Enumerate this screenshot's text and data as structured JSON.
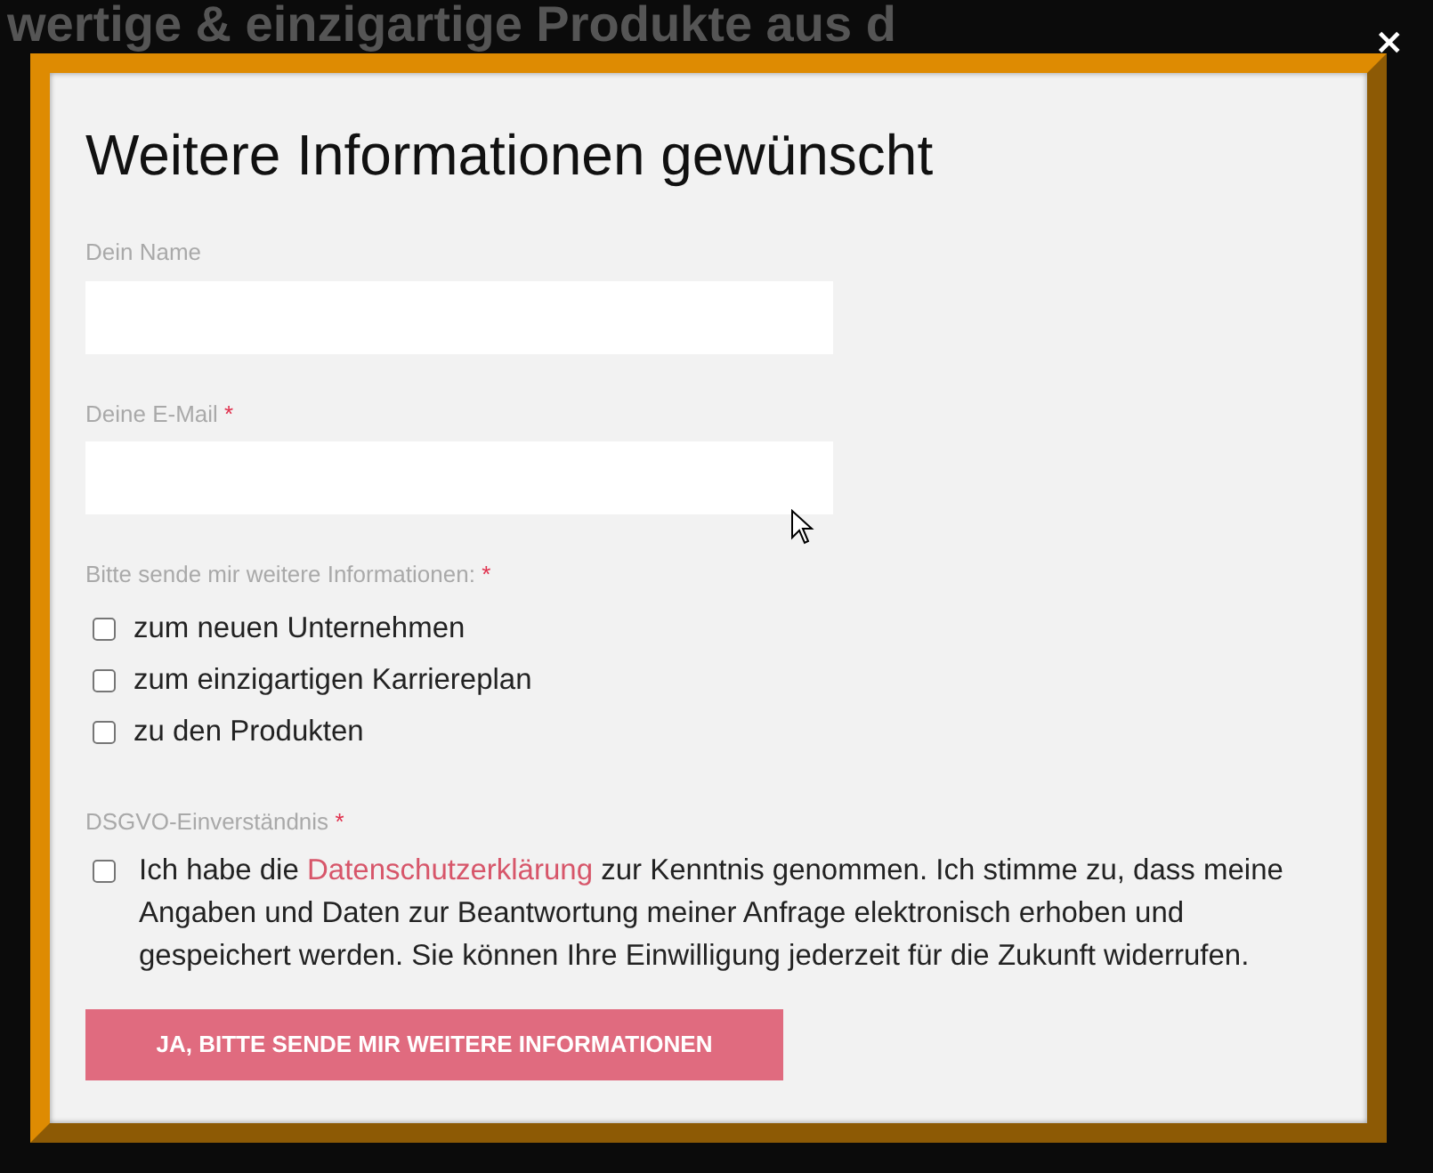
{
  "background": {
    "heading": "wertige & einzigartige Produkte aus d"
  },
  "modal": {
    "close": "×",
    "title": "Weitere Informationen gewünscht",
    "fields": [
      {
        "label": "Dein Name"
      },
      {
        "label": "Deine E-Mail",
        "required_mark": "*"
      }
    ],
    "interests": {
      "label": "Bitte sende mir weitere Informationen:",
      "required_mark": "*",
      "options": [
        {
          "label": "zum neuen Unternehmen",
          "checked": false
        },
        {
          "label": "zum einzigartigen Karriereplan",
          "checked": false
        },
        {
          "label": "zu den Produkten",
          "checked": false
        }
      ]
    },
    "consent": {
      "label": "DSGVO-Einverständnis",
      "required_mark": "*",
      "checked": false,
      "text_before": "Ich habe die",
      "link": "Datenschutzerklärung",
      "text_after": "zur Kenntnis genommen. Ich stimme zu, dass meine Angaben und Daten zur Beantwortung meiner Anfrage elektronisch erhoben und gespeichert werden. Sie können Ihre Einwilligung jederzeit für die Zukunft widerrufen."
    },
    "submit": "JA, BITTE SENDE MIR WEITERE INFORMATIONEN"
  }
}
